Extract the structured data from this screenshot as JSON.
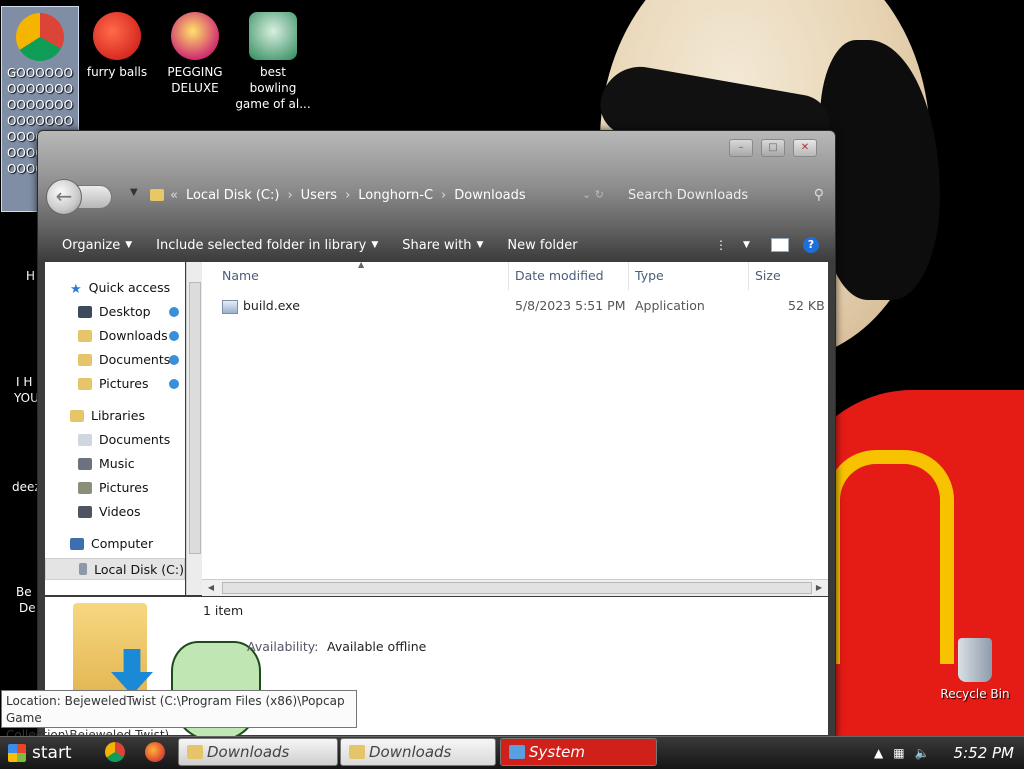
{
  "desktop": {
    "icons": [
      {
        "label": "GOOOOOOOOOOOOOOOOOOOOOOOOOOOOOOOOOOOOOOOOOOOOOOOO",
        "icon": "chrome-icon"
      },
      {
        "label": "furry balls",
        "icon": "furry-balls-icon"
      },
      {
        "label": "PEGGING DELUXE",
        "icon": "pegging-deluxe-icon"
      },
      {
        "label": "best bowling game of al...",
        "icon": "bowling-icon"
      },
      {
        "label": "Recycle Bin",
        "icon": "recycle-bin-icon"
      }
    ],
    "partial_labels": [
      "H",
      "I H",
      "YOU",
      "deez",
      "Be",
      "De"
    ]
  },
  "window": {
    "breadcrumb": [
      "Local Disk (C:)",
      "Users",
      "Longhorn-C",
      "Downloads"
    ],
    "search_placeholder": "Search Downloads",
    "toolbar": {
      "organize": "Organize",
      "include": "Include selected folder in library",
      "share": "Share with",
      "new_folder": "New folder"
    },
    "nav": {
      "quick_access": "Quick access",
      "desktop": "Desktop",
      "downloads": "Downloads",
      "documents": "Documents",
      "pictures": "Pictures",
      "libraries": "Libraries",
      "lib_documents": "Documents",
      "lib_music": "Music",
      "lib_pictures": "Pictures",
      "lib_videos": "Videos",
      "computer": "Computer",
      "local_disk": "Local Disk (C:)"
    },
    "columns": {
      "name": "Name",
      "date": "Date modified",
      "type": "Type",
      "size": "Size"
    },
    "files": [
      {
        "name": "build.exe",
        "date": "5/8/2023 5:51 PM",
        "type": "Application",
        "size": "52 KB"
      }
    ],
    "details": {
      "count": "1 item",
      "availability_label": "Availability:",
      "availability_value": "Available offline"
    }
  },
  "tooltip": {
    "line1": "Location: BejeweledTwist (C:\\Program Files (x86)\\Popcap Game",
    "line2": "Collection\\Bejeweled Twist)"
  },
  "taskbar": {
    "start": "start",
    "tasks": [
      "Downloads",
      "Downloads",
      "System"
    ],
    "clock": "5:52 PM"
  },
  "colors": {
    "task_system": "#d0201a",
    "help_blue": "#1e6fd9",
    "accent_folder": "#e3b451"
  }
}
